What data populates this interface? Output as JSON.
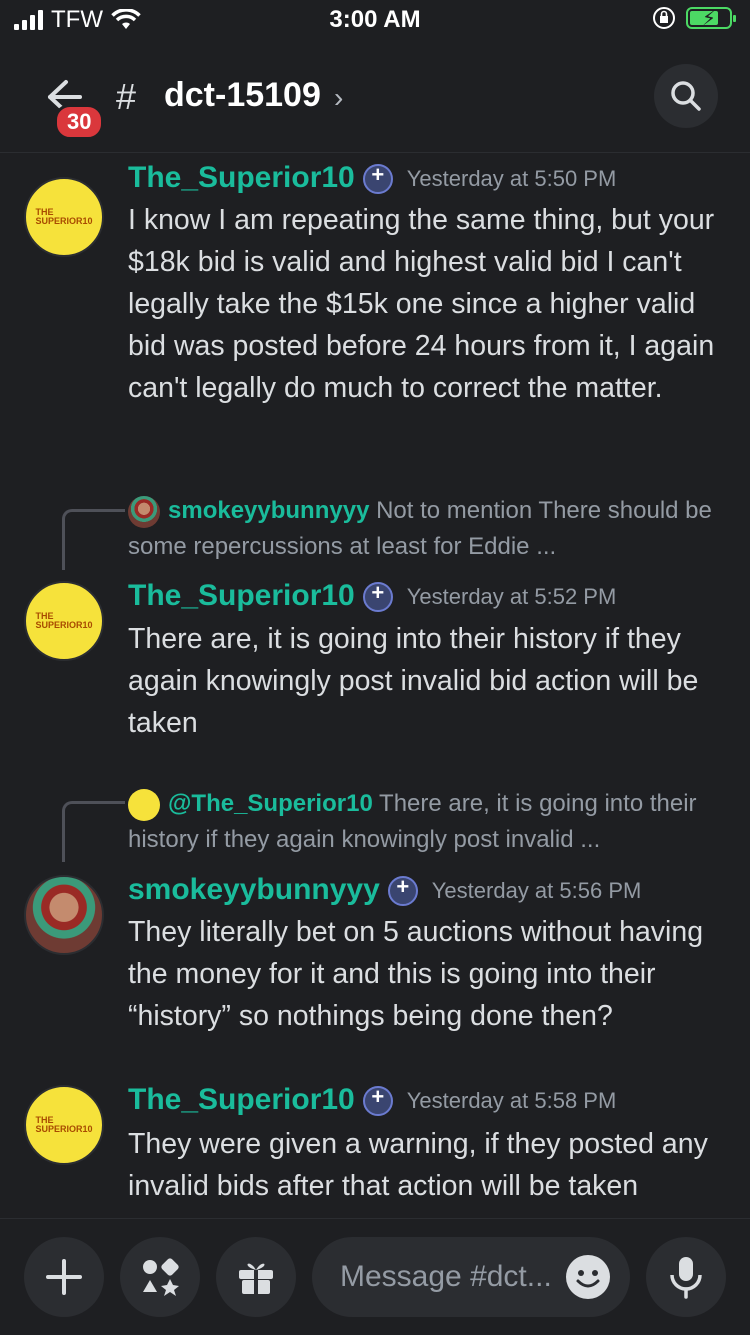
{
  "status": {
    "carrier": "TFW",
    "time": "3:00 AM"
  },
  "header": {
    "unread_count": "30",
    "channel_name": "dct-15109"
  },
  "messages": [
    {
      "author": "The_Superior10",
      "timestamp": "Yesterday at 5:50 PM",
      "text": "I know I am repeating the same thing, but your $18k bid is valid and highest valid bid I can't legally take the $15k one since a higher valid bid was posted before 24 hours from it, I again can't legally do much to correct the matter."
    },
    {
      "reply": {
        "author": "smokeyybunnyyy",
        "preview": "Not to mention There should be some repercussions at least for Eddie ..."
      },
      "author": "The_Superior10",
      "timestamp": "Yesterday at 5:52 PM",
      "text": "There are, it is going into their history if they again knowingly post invalid bid action will be taken"
    },
    {
      "reply": {
        "author": "@The_Superior10",
        "preview": "There are, it is going into their history if they again knowingly post invalid ..."
      },
      "author": "smokeyybunnyyy",
      "timestamp": "Yesterday at 5:56 PM",
      "text": "They literally bet on 5 auctions without having the money for it and this is going into their “history” so nothings being done then?"
    },
    {
      "author": "The_Superior10",
      "timestamp": "Yesterday at 5:58 PM",
      "text": "They were given a warning, if they posted any invalid bids after that action will be taken"
    }
  ],
  "avatar_text": {
    "line1": "THE",
    "line2": "SUPERIOR10"
  },
  "composer": {
    "placeholder": "Message #dct..."
  },
  "colors": {
    "username": "#1abc9c",
    "background": "#1e1f22",
    "badge": "#da373c"
  }
}
